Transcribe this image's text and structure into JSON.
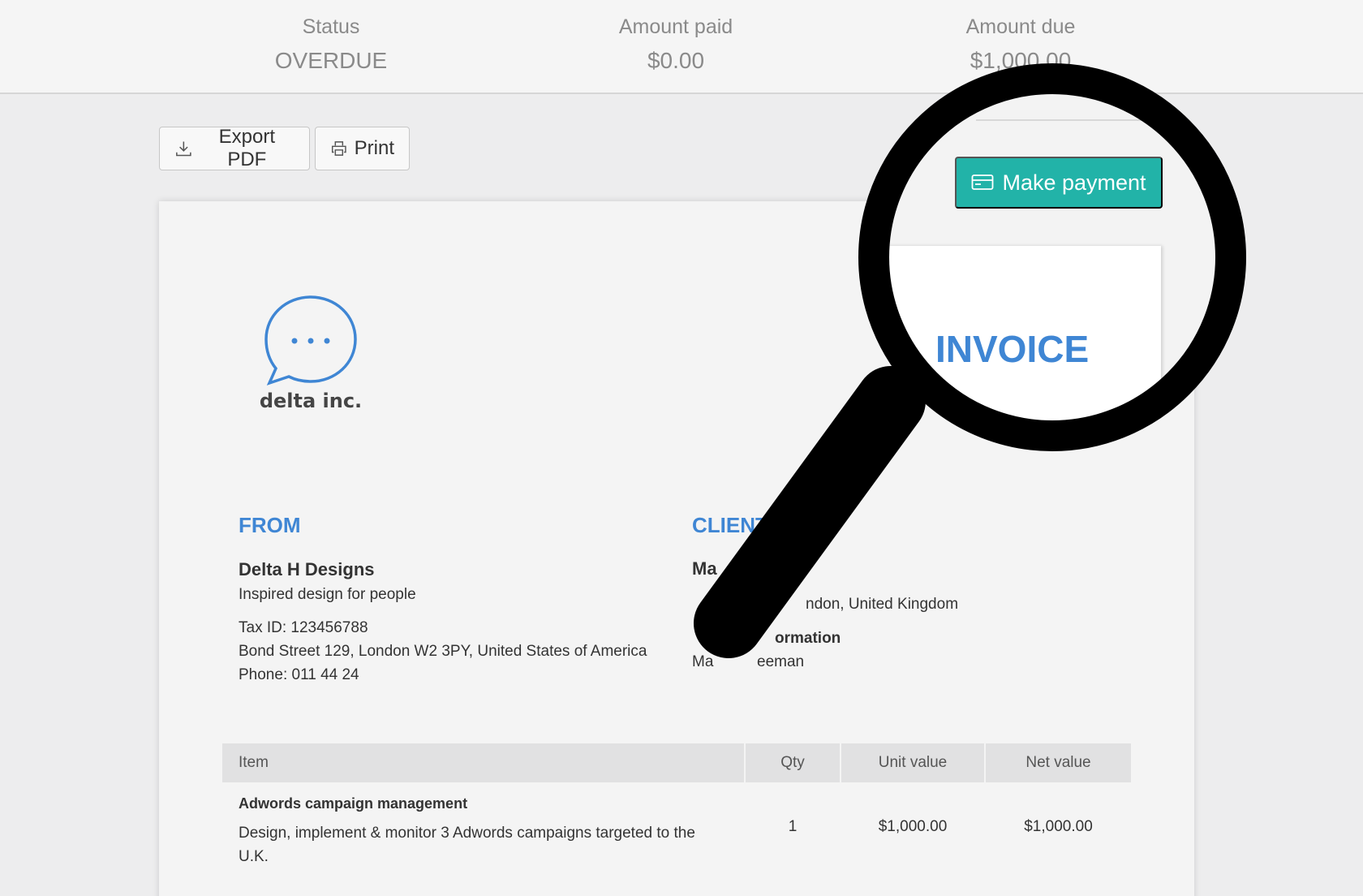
{
  "summary": {
    "status_label": "Status",
    "status_value": "OVERDUE",
    "paid_label": "Amount paid",
    "paid_value": "$0.00",
    "due_label": "Amount due",
    "due_value": "$1,000.00"
  },
  "toolbar": {
    "export_label": "Export PDF",
    "print_label": "Print",
    "pay_label": "Make payment"
  },
  "invoice": {
    "title": "INVOICE",
    "logo_text": "delta inc.",
    "from": {
      "heading": "FROM",
      "name": "Delta H Designs",
      "tagline": "Inspired design for people",
      "tax_id": "Tax ID: 123456788",
      "address": "Bond Street 129, London W2 3PY, United States of America",
      "phone": "Phone: 011 44 24"
    },
    "client": {
      "heading": "CLIENT",
      "name_fragment": "Ma",
      "address_fragment": "ndon, United Kingdom",
      "info_fragment": "ormation",
      "contact_fragment_a": "Ma",
      "contact_fragment_b": "eeman"
    },
    "table": {
      "headers": {
        "item": "Item",
        "qty": "Qty",
        "unit": "Unit value",
        "net": "Net value"
      },
      "rows": [
        {
          "title": "Adwords campaign management",
          "description": "Design, implement & monitor 3 Adwords campaigns targeted to the U.K.",
          "qty": "1",
          "unit": "$1,000.00",
          "net": "$1,000.00"
        }
      ]
    }
  },
  "colors": {
    "accent": "#3f86d4",
    "pay_button": "#22b3a8"
  }
}
